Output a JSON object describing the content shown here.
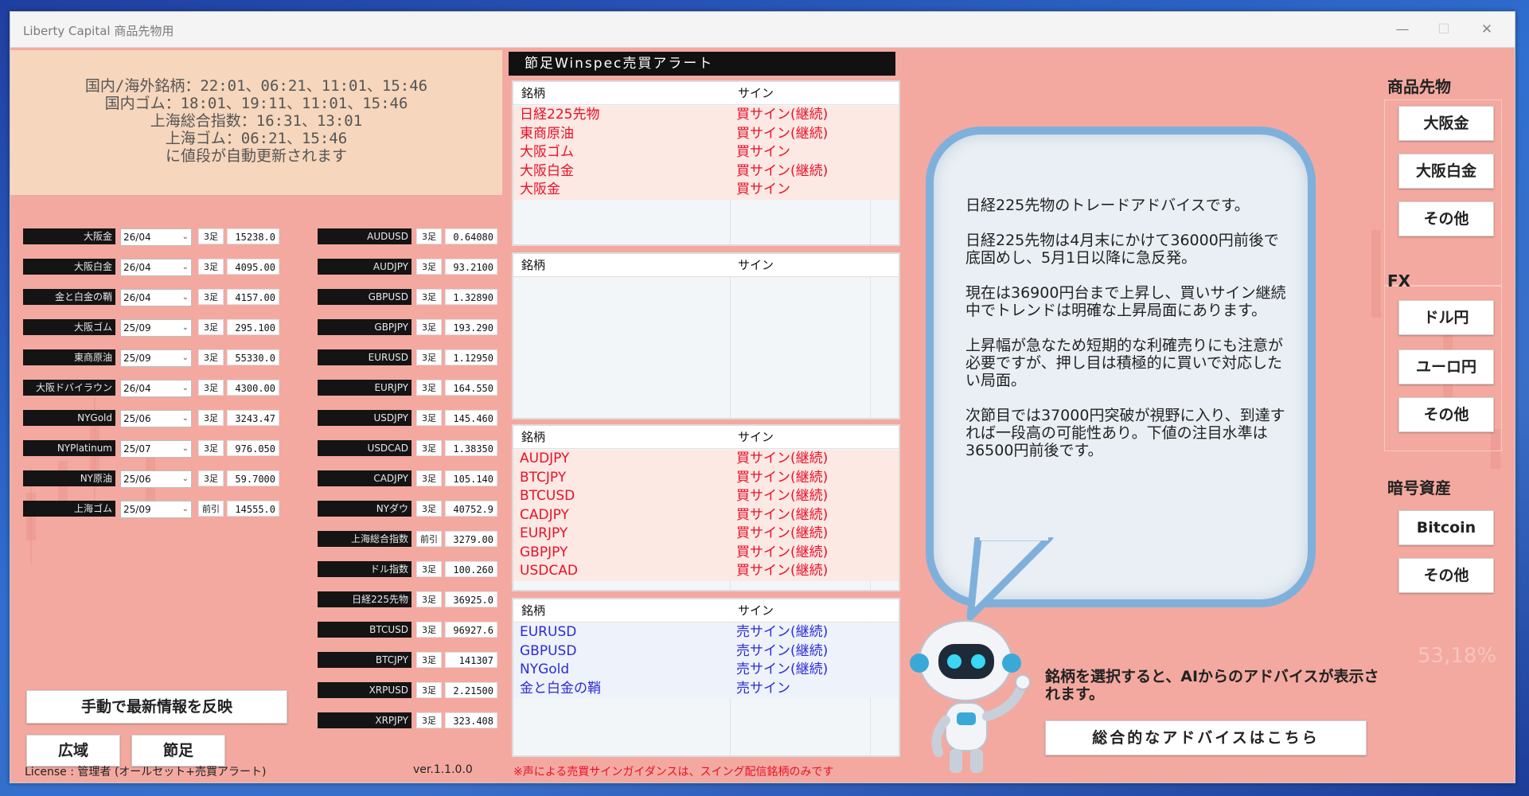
{
  "window": {
    "title": "Liberty Capital 商品先物用"
  },
  "schedule": [
    "国内/海外銘柄：22:01、06:21、11:01、15:46",
    "国内ゴム：18:01、19:11、11:01、15:46",
    "上海総合指数：16:31、13:01",
    "上海ゴム：06:21、15:46",
    "に値段が自動更新されます"
  ],
  "commodities": [
    {
      "label": "大阪金",
      "month": "26/04",
      "tag": "3足",
      "value": "15238.0"
    },
    {
      "label": "大阪白金",
      "month": "26/04",
      "tag": "3足",
      "value": "4095.00"
    },
    {
      "label": "金と白金の鞘",
      "month": "26/04",
      "tag": "3足",
      "value": "4157.00"
    },
    {
      "label": "大阪ゴム",
      "month": "25/09",
      "tag": "3足",
      "value": "295.100"
    },
    {
      "label": "東商原油",
      "month": "25/09",
      "tag": "3足",
      "value": "55330.0"
    },
    {
      "label": "大阪ドバイラウン",
      "month": "26/04",
      "tag": "3足",
      "value": "4300.00"
    },
    {
      "label": "NYGold",
      "month": "25/06",
      "tag": "3足",
      "value": "3243.47"
    },
    {
      "label": "NYPlatinum",
      "month": "25/07",
      "tag": "3足",
      "value": "976.050"
    },
    {
      "label": "NY原油",
      "month": "25/06",
      "tag": "3足",
      "value": "59.7000"
    },
    {
      "label": "上海ゴム",
      "month": "25/09",
      "tag": "前引",
      "value": "14555.0"
    }
  ],
  "fx": [
    {
      "label": "AUDUSD",
      "tag": "3足",
      "value": "0.64080"
    },
    {
      "label": "AUDJPY",
      "tag": "3足",
      "value": "93.2100"
    },
    {
      "label": "GBPUSD",
      "tag": "3足",
      "value": "1.32890"
    },
    {
      "label": "GBPJPY",
      "tag": "3足",
      "value": "193.290"
    },
    {
      "label": "EURUSD",
      "tag": "3足",
      "value": "1.12950"
    },
    {
      "label": "EURJPY",
      "tag": "3足",
      "value": "164.550"
    },
    {
      "label": "USDJPY",
      "tag": "3足",
      "value": "145.460"
    },
    {
      "label": "USDCAD",
      "tag": "3足",
      "value": "1.38350"
    },
    {
      "label": "CADJPY",
      "tag": "3足",
      "value": "105.140"
    },
    {
      "label": "NYダウ",
      "tag": "3足",
      "value": "40752.9"
    },
    {
      "label": "上海総合指数",
      "tag": "前引",
      "value": "3279.00"
    },
    {
      "label": "ドル指数",
      "tag": "3足",
      "value": "100.260"
    },
    {
      "label": "日経225先物",
      "tag": "3足",
      "value": "36925.0"
    },
    {
      "label": "BTCUSD",
      "tag": "3足",
      "value": "96927.6"
    },
    {
      "label": "BTCJPY",
      "tag": "3足",
      "value": "141307"
    },
    {
      "label": "XRPUSD",
      "tag": "3足",
      "value": "2.21500"
    },
    {
      "label": "XRPJPY",
      "tag": "3足",
      "value": "323.408"
    }
  ],
  "buttons": {
    "refresh": "手動で最新情報を反映",
    "wide": "広域",
    "daily": "節足",
    "overall": "総合的なアドバイスはこちら"
  },
  "footer": {
    "license": "License : 管理者 (オールセット+売買アラート)",
    "version": "ver.1.1.0.0",
    "disclaimer": "※声による売買サインガイダンスは、スイング配信銘柄のみです"
  },
  "alerts": {
    "header": "節足Winspec売買アラート",
    "col_symbol": "銘柄",
    "col_sign": "サイン",
    "panel1": [
      {
        "symbol": "日経225先物",
        "sign": "買サイン(継続)"
      },
      {
        "symbol": "東商原油",
        "sign": "買サイン(継続)"
      },
      {
        "symbol": "大阪ゴム",
        "sign": "買サイン"
      },
      {
        "symbol": "大阪白金",
        "sign": "買サイン(継続)"
      },
      {
        "symbol": "大阪金",
        "sign": "買サイン"
      }
    ],
    "panel2": [],
    "panel3": [
      {
        "symbol": "AUDJPY",
        "sign": "買サイン(継続)"
      },
      {
        "symbol": "BTCJPY",
        "sign": "買サイン(継続)"
      },
      {
        "symbol": "BTCUSD",
        "sign": "買サイン(継続)"
      },
      {
        "symbol": "CADJPY",
        "sign": "買サイン(継続)"
      },
      {
        "symbol": "EURJPY",
        "sign": "買サイン(継続)"
      },
      {
        "symbol": "GBPJPY",
        "sign": "買サイン(継続)"
      },
      {
        "symbol": "USDCAD",
        "sign": "買サイン(継続)"
      }
    ],
    "panel4": [
      {
        "symbol": "EURUSD",
        "sign": "売サイン(継続)"
      },
      {
        "symbol": "GBPUSD",
        "sign": "売サイン(継続)"
      },
      {
        "symbol": "NYGold",
        "sign": "売サイン(継続)"
      },
      {
        "symbol": "金と白金の鞘",
        "sign": "売サイン"
      }
    ]
  },
  "advice": {
    "p1": "日経225先物のトレードアドバイスです。",
    "p2": "日経225先物は4月末にかけて36000円前後で底固めし、5月1日以降に急反発。",
    "p3": "現在は36900円台まで上昇し、買いサイン継続中でトレンドは明確な上昇局面にあります。",
    "p4": "上昇幅が急なため短期的な利確売りにも注意が必要ですが、押し目は積極的に買いで対応したい局面。",
    "p5": "次節目では37000円突破が視野に入り、到達すれば一段高の可能性あり。下値の注目水準は36500円前後です。"
  },
  "hint": "銘柄を選択すると、AIからのアドバイスが表示されます。",
  "side": {
    "commodity_header": "商品先物",
    "commodity_buttons": [
      "大阪金",
      "大阪白金",
      "その他"
    ],
    "fx_header": "FX",
    "fx_buttons": [
      "ドル円",
      "ユーロ円",
      "その他"
    ],
    "crypto_header": "暗号資産",
    "crypto_buttons": [
      "Bitcoin",
      "その他"
    ]
  },
  "bg_number": "53,18%",
  "colors": {
    "buy": "#e8102a",
    "sell": "#2b2bd6",
    "panel_bg": "#f3a9a0",
    "bubble_border": "#7fb0db"
  }
}
